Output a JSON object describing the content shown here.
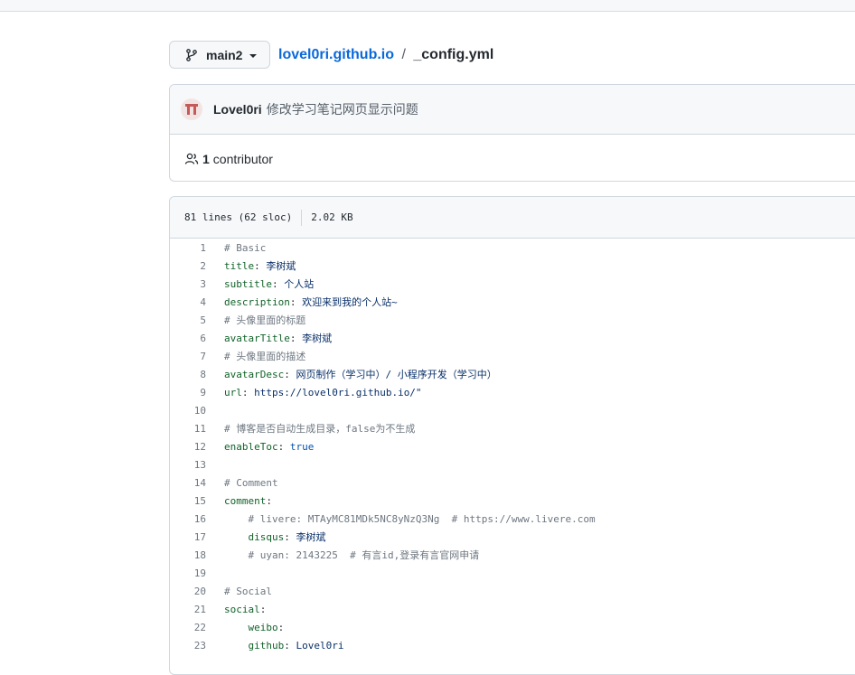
{
  "branch": {
    "name": "main2",
    "icon": "git-branch-icon"
  },
  "breadcrumb": {
    "repo": "lovel0ri.github.io",
    "separator": "/",
    "file": "_config.yml"
  },
  "commit": {
    "author": "Lovel0ri",
    "message": "修改学习笔记网页显示问题",
    "avatar_icon": "avatar-identicon"
  },
  "contributors": {
    "count": "1",
    "label": "contributor",
    "icon": "people-icon"
  },
  "file_info": {
    "lines": "81 lines (62 sloc)",
    "size": "2.02 KB"
  },
  "code_lines": [
    {
      "n": "1",
      "key": "",
      "val": "",
      "comment": "# Basic",
      "indent": ""
    },
    {
      "n": "2",
      "key": "title",
      "val": "李树斌",
      "comment": "",
      "indent": ""
    },
    {
      "n": "3",
      "key": "subtitle",
      "val": "个人站",
      "comment": "",
      "indent": ""
    },
    {
      "n": "4",
      "key": "description",
      "val": "欢迎来到我的个人站~",
      "comment": "",
      "indent": ""
    },
    {
      "n": "5",
      "key": "",
      "val": "",
      "comment": "# 头像里面的标题",
      "indent": ""
    },
    {
      "n": "6",
      "key": "avatarTitle",
      "val": "李树斌",
      "comment": "",
      "indent": ""
    },
    {
      "n": "7",
      "key": "",
      "val": "",
      "comment": "# 头像里面的描述",
      "indent": ""
    },
    {
      "n": "8",
      "key": "avatarDesc",
      "val": "网页制作（学习中）/ 小程序开发（学习中）",
      "comment": "",
      "indent": ""
    },
    {
      "n": "9",
      "key": "url",
      "val": "https://lovel0ri.github.io/\"",
      "comment": "",
      "indent": ""
    },
    {
      "n": "10",
      "key": "",
      "val": "",
      "comment": "",
      "indent": ""
    },
    {
      "n": "11",
      "key": "",
      "val": "",
      "comment": "# 博客是否自动生成目录，false为不生成",
      "indent": ""
    },
    {
      "n": "12",
      "key": "enableToc",
      "val": "true",
      "comment": "",
      "indent": "",
      "bool": true
    },
    {
      "n": "13",
      "key": "",
      "val": "",
      "comment": "",
      "indent": ""
    },
    {
      "n": "14",
      "key": "",
      "val": "",
      "comment": "# Comment",
      "indent": ""
    },
    {
      "n": "15",
      "key": "comment",
      "val": "",
      "comment": "",
      "indent": ""
    },
    {
      "n": "16",
      "key": "",
      "val": "",
      "comment": "# livere: MTAyMC81MDk5NC8yNzQ3Ng  # https://www.livere.com",
      "indent": "    "
    },
    {
      "n": "17",
      "key": "disqus",
      "val": "李树斌",
      "comment": "",
      "indent": "    "
    },
    {
      "n": "18",
      "key": "",
      "val": "",
      "comment": "# uyan: 2143225  # 有言id,登录有言官网申请",
      "indent": "    "
    },
    {
      "n": "19",
      "key": "",
      "val": "",
      "comment": "",
      "indent": ""
    },
    {
      "n": "20",
      "key": "",
      "val": "",
      "comment": "# Social",
      "indent": ""
    },
    {
      "n": "21",
      "key": "social",
      "val": "",
      "comment": "",
      "indent": ""
    },
    {
      "n": "22",
      "key": "weibo",
      "val": "",
      "comment": "",
      "indent": "    "
    },
    {
      "n": "23",
      "key": "github",
      "val": "Lovel0ri",
      "comment": "",
      "indent": "    "
    }
  ]
}
